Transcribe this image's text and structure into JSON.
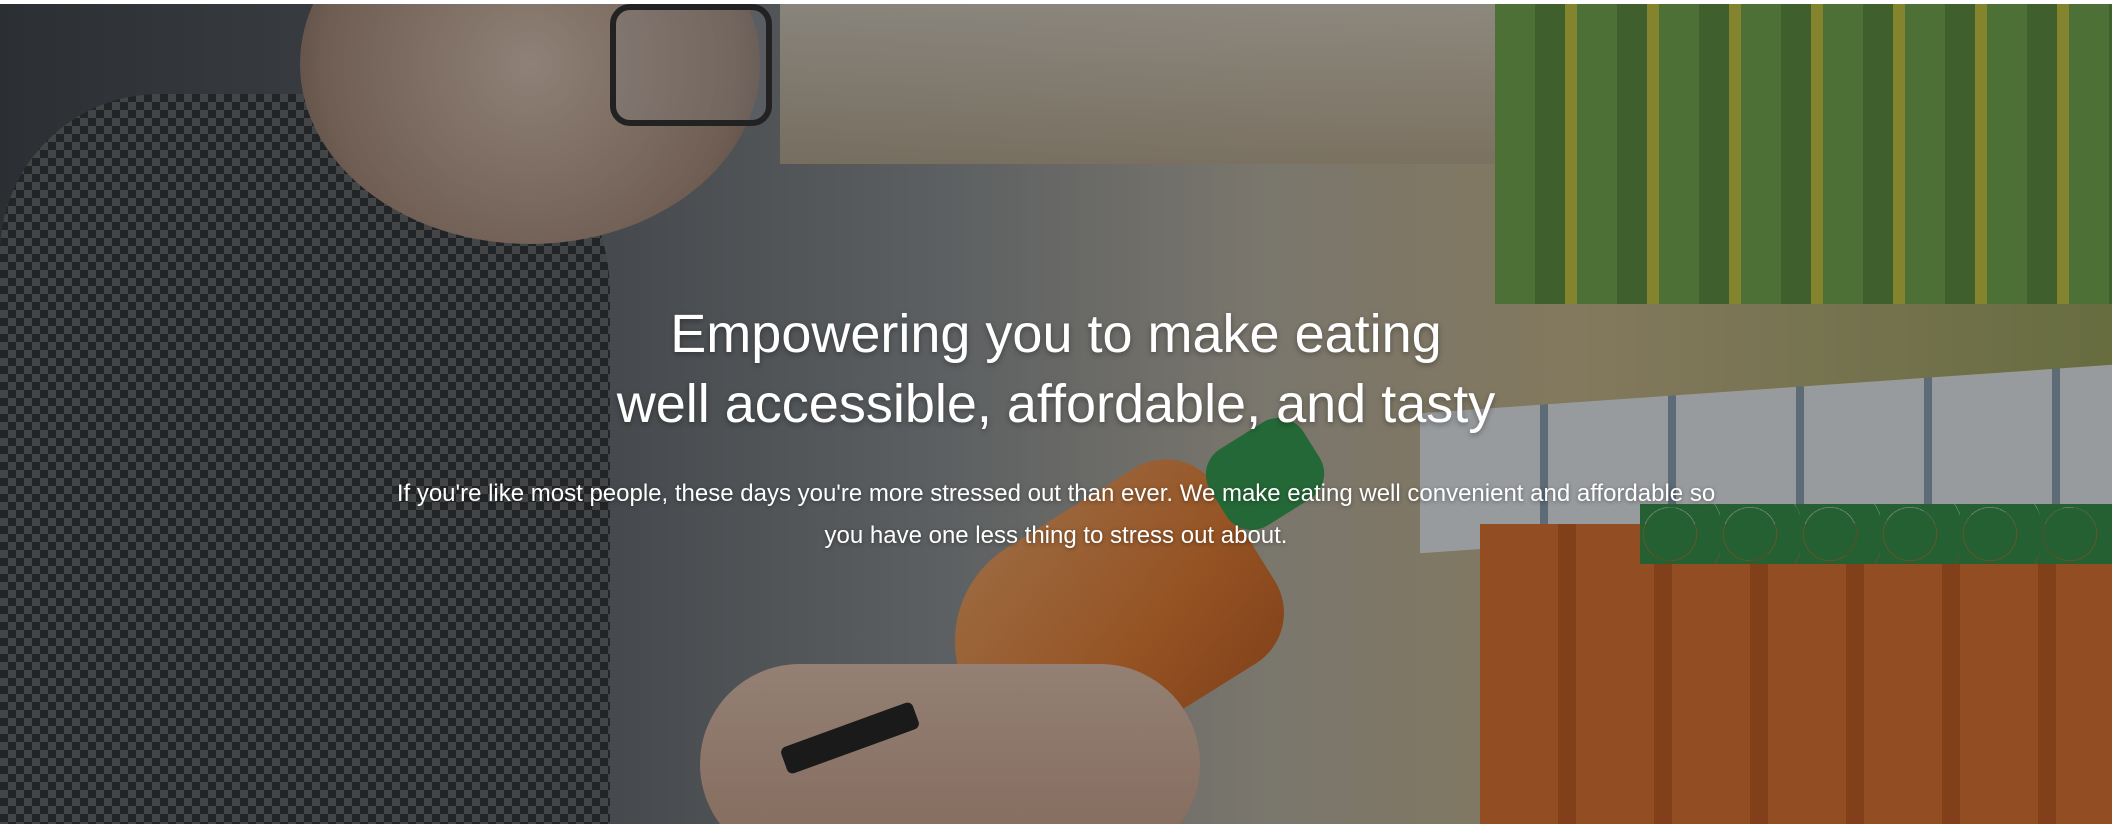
{
  "hero": {
    "headline_line1": "Empowering you to make eating",
    "headline_line2": "well accessible, affordable, and tasty",
    "subtext_line1": "If you're like most people, these days you're more stressed out than ever. We make eating well convenient and affordable so",
    "subtext_line2": "you have one less thing to stress out about."
  },
  "colors": {
    "text": "#ffffff",
    "overlay": "rgba(20,20,20,0.38)"
  }
}
